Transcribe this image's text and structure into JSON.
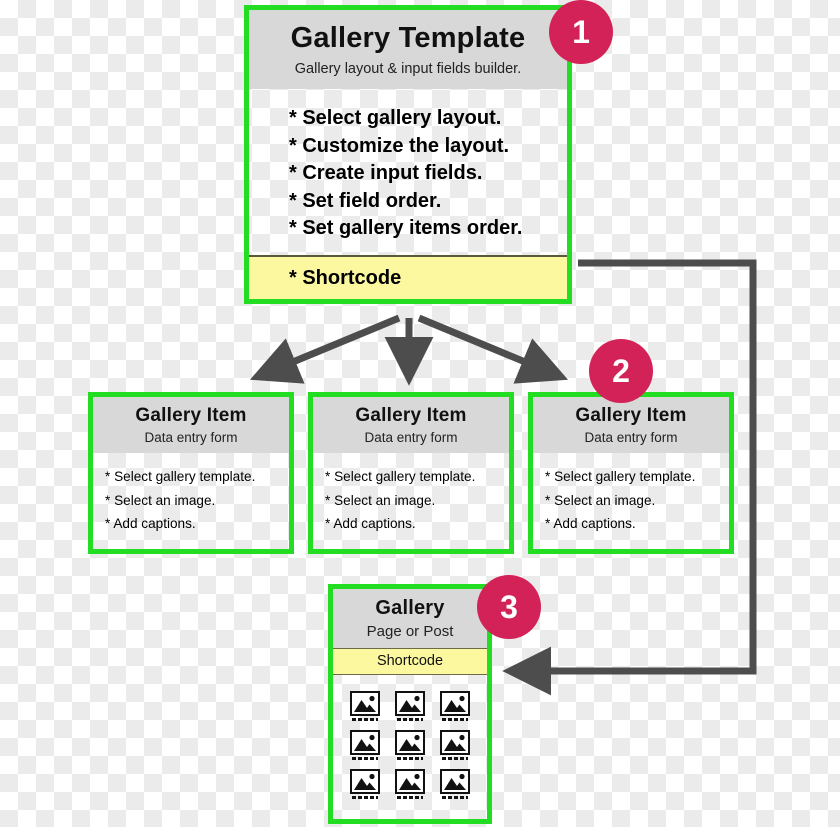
{
  "colors": {
    "box_border": "#22dd22",
    "header_band": "#d8d8d8",
    "shortcode_band": "#fbf8a0",
    "badge": "#d32257",
    "arrow": "#4d4d4d"
  },
  "template_box": {
    "title": "Gallery Template",
    "subtitle": "Gallery layout & input fields builder.",
    "items": [
      "* Select gallery layout.",
      "* Customize the layout.",
      "* Create input fields.",
      "* Set field order.",
      "* Set gallery items order."
    ],
    "shortcode_label": "* Shortcode"
  },
  "gallery_items": [
    {
      "title": "Gallery Item",
      "subtitle": "Data entry form",
      "items": [
        "* Select gallery template.",
        "* Select an image.",
        "* Add captions."
      ]
    },
    {
      "title": "Gallery Item",
      "subtitle": "Data entry form",
      "items": [
        "* Select gallery template.",
        "* Select an image.",
        "* Add captions."
      ]
    },
    {
      "title": "Gallery Item",
      "subtitle": "Data entry form",
      "items": [
        "* Select gallery template.",
        "* Select an image.",
        "* Add captions."
      ]
    }
  ],
  "gallery_page": {
    "title": "Gallery",
    "subtitle": "Page or Post",
    "shortcode_label": "Shortcode",
    "thumbnail_count": 9,
    "thumbnail_icon": "image-placeholder-icon"
  },
  "badges": [
    {
      "number": "1",
      "target": "gallery-template-box"
    },
    {
      "number": "2",
      "target": "gallery-item-box-3"
    },
    {
      "number": "3",
      "target": "gallery-page-box"
    }
  ],
  "connectors": [
    {
      "name": "template-to-item-1",
      "type": "arrow"
    },
    {
      "name": "template-to-item-2",
      "type": "arrow"
    },
    {
      "name": "template-to-item-3",
      "type": "arrow"
    },
    {
      "name": "shortcode-feedback-loop",
      "type": "elbow-arrow"
    }
  ]
}
